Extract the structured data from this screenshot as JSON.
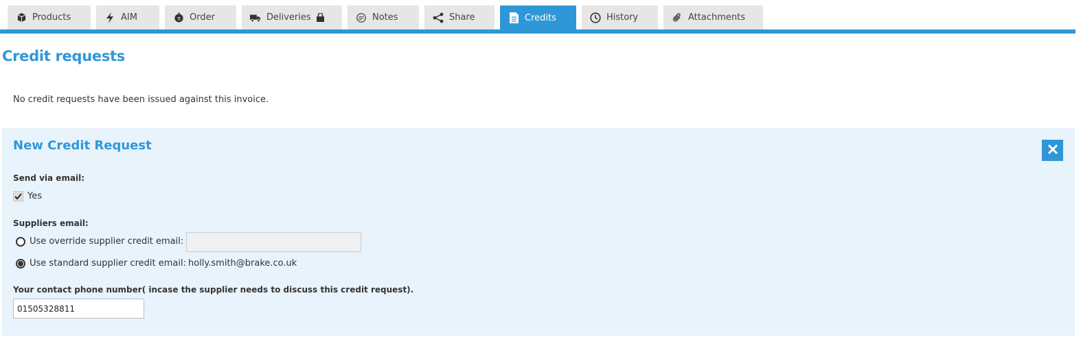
{
  "tabs": [
    {
      "label": "Products",
      "icon": "box-icon"
    },
    {
      "label": "AIM",
      "icon": "lightning-icon"
    },
    {
      "label": "Order",
      "icon": "order-icon"
    },
    {
      "label": "Deliveries",
      "icon": "truck-icon"
    },
    {
      "label": "Notes",
      "icon": "speech-bubble-icon"
    },
    {
      "label": "Share",
      "icon": "share-icon"
    },
    {
      "label": "Credits",
      "icon": "document-icon",
      "active": true
    },
    {
      "label": "History",
      "icon": "clock-icon"
    },
    {
      "label": "Attachments",
      "icon": "paperclip-icon"
    }
  ],
  "page": {
    "title": "Credit requests",
    "no_requests_text": "No credit requests have been issued against this invoice."
  },
  "form": {
    "title": "New Credit Request",
    "send_via_email_label": "Send via email:",
    "send_via_email_option": "Yes",
    "send_via_email_checked": true,
    "suppliers_email_label": "Suppliers email:",
    "override_option": "Use override supplier credit email:",
    "override_value": "",
    "standard_option": "Use standard supplier credit email:",
    "standard_email": "holly.smith@brake.co.uk",
    "selected_option": "standard",
    "phone_label": "Your contact phone number( incase the supplier needs to discuss this credit request).",
    "phone_value": "01505328811"
  },
  "colors": {
    "accent": "#2f97d8",
    "tab_bg": "#e6e6e6",
    "panel_bg": "#e8f3fb"
  }
}
